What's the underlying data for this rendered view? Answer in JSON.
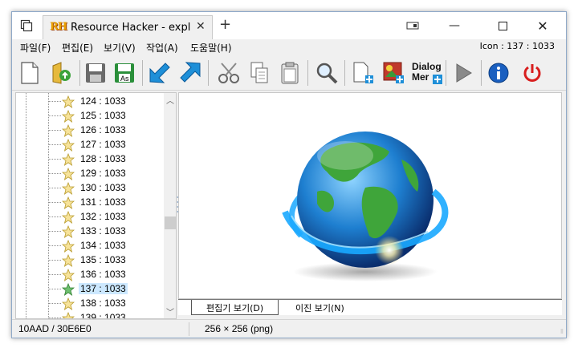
{
  "window": {
    "tab_title": "Resource Hacker - expl",
    "logo_text": "RH"
  },
  "menu": {
    "items": [
      "파일(F)",
      "편집(E)",
      "보기(V)",
      "작업(A)",
      "도움말(H)"
    ],
    "status_right": "Icon : 137 : 1033"
  },
  "toolbar": {
    "buttons": [
      {
        "icon": "new-file-icon"
      },
      {
        "icon": "open-folder-icon"
      },
      {
        "icon": "save-icon"
      },
      {
        "icon": "save-as-icon",
        "label": "As"
      },
      {
        "icon": "compile-down-icon"
      },
      {
        "icon": "compile-up-icon"
      },
      {
        "icon": "cut-icon"
      },
      {
        "icon": "copy-icon"
      },
      {
        "icon": "paste-icon"
      },
      {
        "icon": "find-icon"
      },
      {
        "icon": "add-resource-icon"
      },
      {
        "icon": "add-image-icon"
      },
      {
        "icon": "dialog-menu-icon",
        "label_line1": "Dialog",
        "label_line2": "Mer"
      },
      {
        "icon": "play-icon"
      },
      {
        "icon": "info-icon"
      },
      {
        "icon": "power-icon"
      }
    ]
  },
  "tree": {
    "items": [
      "124 : 1033",
      "125 : 1033",
      "126 : 1033",
      "127 : 1033",
      "128 : 1033",
      "129 : 1033",
      "130 : 1033",
      "131 : 1033",
      "132 : 1033",
      "133 : 1033",
      "134 : 1033",
      "135 : 1033",
      "136 : 1033",
      "137 : 1033",
      "138 : 1033",
      "139 : 1033"
    ],
    "selected": "137 : 1033"
  },
  "view_tabs": {
    "edit_view": "편집기 보기(D)",
    "binary_view": "이진 보기(N)"
  },
  "status": {
    "left": "10AAD / 30E6E0",
    "right": "256 × 256 (png)"
  },
  "colors": {
    "selection": "#cce8ff",
    "accent_blue": "#1e8fd8",
    "power_red": "#d81e1e"
  }
}
